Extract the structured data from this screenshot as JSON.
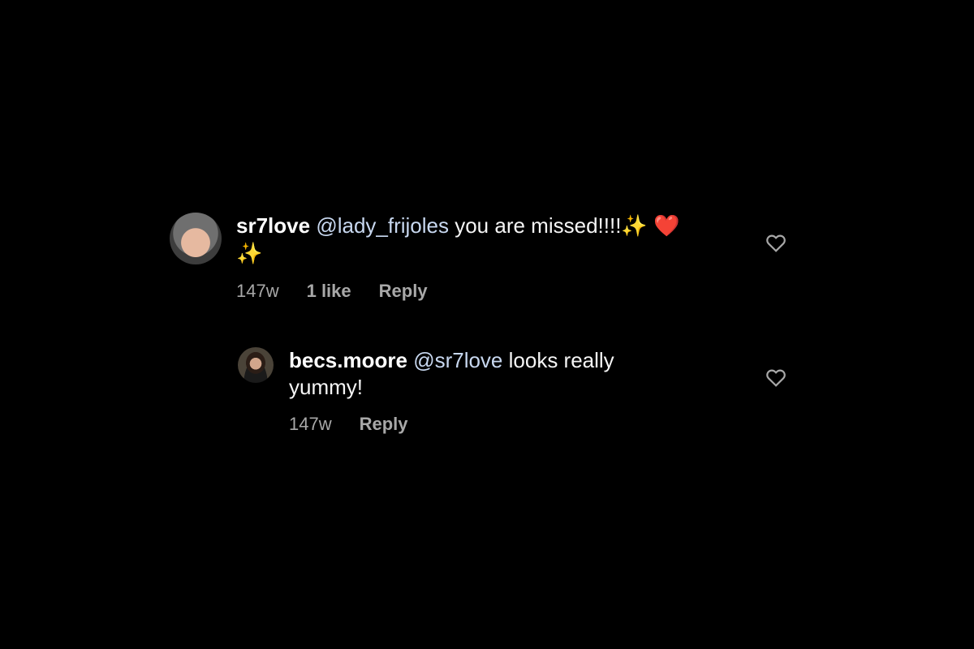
{
  "comments": [
    {
      "username": "sr7love",
      "mention": "@lady_frijoles",
      "text": " you are missed!!!!",
      "emoji_after_text": "✨",
      "emoji_heart": "❤️",
      "emoji_second_line": "✨",
      "time": "147w",
      "likes": "1 like",
      "reply_label": "Reply",
      "avatar_icon": "user-avatar"
    },
    {
      "username": "becs.moore",
      "mention": "@sr7love",
      "text_line1": " looks really",
      "text_line2": "yummy!",
      "time": "147w",
      "reply_label": "Reply",
      "avatar_icon": "user-avatar"
    }
  ],
  "icons": {
    "like": "heart-outline-icon",
    "like_color": "#a8a8a8"
  }
}
